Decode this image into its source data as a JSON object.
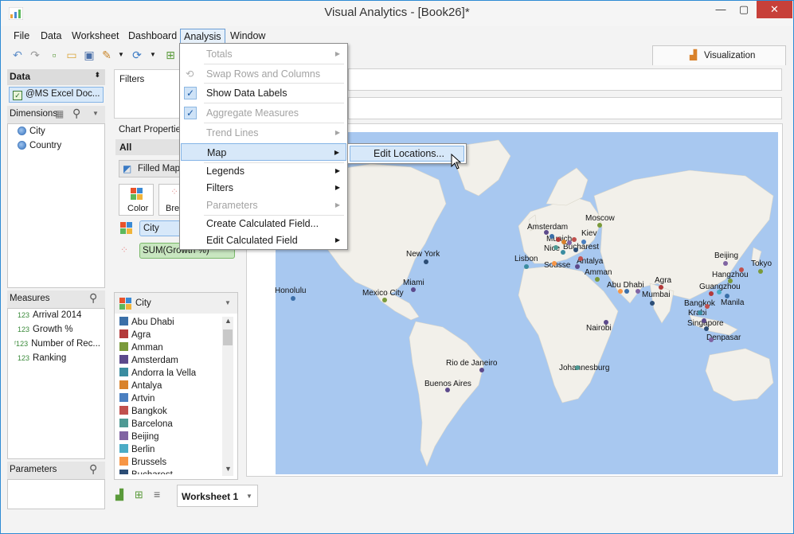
{
  "app": {
    "title": "Visual Analytics - [Book26]*",
    "minimize": "—",
    "maximize": "▢",
    "close": "✕"
  },
  "menu": {
    "file": "File",
    "data": "Data",
    "worksheet": "Worksheet",
    "dashboard": "Dashboard",
    "analysis": "Analysis",
    "window": "Window"
  },
  "visualization_tab": "Visualization",
  "data_panel": {
    "title": "Data",
    "source": "@MS Excel Doc...",
    "dimensions_label": "Dimensions",
    "dimensions": [
      "City",
      "Country"
    ],
    "measures_label": "Measures",
    "measures": [
      "Arrival 2014",
      "Growth %",
      "Number of Rec...",
      "Ranking"
    ],
    "parameters_label": "Parameters"
  },
  "filters_label": "Filters",
  "chart_properties": {
    "label": "Chart Properties",
    "all_label": "All",
    "chart_type": "Filled Map",
    "color_btn": "Color",
    "breakdown_btn": "Bre",
    "pill_city": "City",
    "pill_growth": "SUM(Growth %)"
  },
  "city_legend": {
    "title": "City",
    "items": [
      {
        "name": "Abu Dhabi",
        "color": "#3b6fa8"
      },
      {
        "name": "Agra",
        "color": "#b33a3a"
      },
      {
        "name": "Amman",
        "color": "#7a9a3a"
      },
      {
        "name": "Amsterdam",
        "color": "#5c4a8c"
      },
      {
        "name": "Andorra la Vella",
        "color": "#3a8ca0"
      },
      {
        "name": "Antalya",
        "color": "#d9822b"
      },
      {
        "name": "Artvin",
        "color": "#4a7fc0"
      },
      {
        "name": "Bangkok",
        "color": "#c0504d"
      },
      {
        "name": "Barcelona",
        "color": "#4f9a94"
      },
      {
        "name": "Beijing",
        "color": "#8064a2"
      },
      {
        "name": "Berlin",
        "color": "#4bacc6"
      },
      {
        "name": "Brussels",
        "color": "#f79646"
      },
      {
        "name": "Bucharest",
        "color": "#2c4d75"
      }
    ]
  },
  "worksheet_tab": "Worksheet 1",
  "analysis_menu": {
    "totals": "Totals",
    "swap": "Swap Rows and Columns",
    "show_labels": "Show Data Labels",
    "aggregate": "Aggregate Measures",
    "trend": "Trend Lines",
    "map": "Map",
    "legends": "Legends",
    "filters": "Filters",
    "parameters": "Parameters",
    "create_calc": "Create Calculated Field...",
    "edit_calc": "Edit Calculated Field"
  },
  "map_submenu": {
    "edit_locations": "Edit Locations..."
  },
  "map_labels": {
    "moscow": "Moscow",
    "amsterdam": "Amsterdam",
    "kiev": "Kiev",
    "munich": "Munich",
    "nice": "Nice",
    "bucharest": "Bucharest",
    "lisbon": "Lisbon",
    "antalya": "Antalya",
    "sousse": "Sousse",
    "amman": "Amman",
    "new_york": "New York",
    "honolulu": "Honolulu",
    "miami": "Miami",
    "mexico_city": "Mexico City",
    "abu_dhabi": "Abu Dhabi",
    "agra": "Agra",
    "mumbai": "Mumbai",
    "beijing": "Beijing",
    "tokyo": "Tokyo",
    "hangzhou": "Hangzhou",
    "guangzhou": "Guangzhou",
    "bangkok": "Bangkok",
    "manila": "Manila",
    "krabi": "Krabi",
    "singapore": "Singapore",
    "denpasar": "Denpasar",
    "nairobi": "Nairobi",
    "rio": "Rio de Janeiro",
    "johannesburg": "Johannesburg",
    "buenos_aires": "Buenos Aires"
  }
}
